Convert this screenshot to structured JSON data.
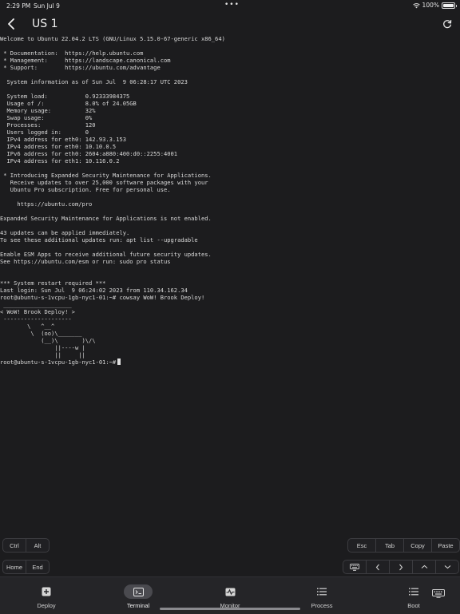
{
  "status_bar": {
    "time": "2:29 PM",
    "date": "Sun Jul 9",
    "battery": "100%",
    "battery_level": 1.0
  },
  "nav": {
    "title": "US 1",
    "back_icon": "chevron-left-icon",
    "refresh_icon": "refresh-icon"
  },
  "terminal": {
    "lines": [
      "Welcome to Ubuntu 22.04.2 LTS (GNU/Linux 5.15.0-67-generic x86_64)",
      "",
      " * Documentation:  https://help.ubuntu.com",
      " * Management:     https://landscape.canonical.com",
      " * Support:        https://ubuntu.com/advantage",
      "",
      "  System information as of Sun Jul  9 06:28:17 UTC 2023",
      "",
      "  System load:           0.92333984375",
      "  Usage of /:            8.0% of 24.05GB",
      "  Memory usage:          32%",
      "  Swap usage:            0%",
      "  Processes:             120",
      "  Users logged in:       0",
      "  IPv4 address for eth0: 142.93.3.153",
      "  IPv4 address for eth0: 10.10.0.5",
      "  IPv6 address for eth0: 2604:a880:400:d0::2255:4001",
      "  IPv4 address for eth1: 10.116.0.2",
      "",
      " * Introducing Expanded Security Maintenance for Applications.",
      "   Receive updates to over 25,000 software packages with your",
      "   Ubuntu Pro subscription. Free for personal use.",
      "",
      "     https://ubuntu.com/pro",
      "",
      "Expanded Security Maintenance for Applications is not enabled.",
      "",
      "43 updates can be applied immediately.",
      "To see these additional updates run: apt list --upgradable",
      "",
      "Enable ESM Apps to receive additional future security updates.",
      "See https://ubuntu.com/esm or run: sudo pro status",
      "",
      "",
      "*** System restart required ***",
      "Last login: Sun Jul  9 06:24:02 2023 from 110.34.162.34",
      "root@ubuntu-s-1vcpu-1gb-nyc1-01:~# cowsay WoW! Brook Deploy!",
      " ____________________",
      "< WoW! Brook Deploy! >",
      " --------------------",
      "        \\   ^__^",
      "         \\  (oo)\\_______",
      "            (__)\\       )\\/\\",
      "                ||----w |",
      "                ||     ||",
      "root@ubuntu-s-1vcpu-1gb-nyc1-01:~#"
    ]
  },
  "keys": {
    "ctrl": "Ctrl",
    "alt": "Alt",
    "esc": "Esc",
    "tab": "Tab",
    "copy": "Copy",
    "paste": "Paste",
    "home": "Home",
    "end": "End"
  },
  "tabs": [
    {
      "label": "Deploy",
      "icon": "plus-square-icon"
    },
    {
      "label": "Terminal",
      "icon": "terminal-icon"
    },
    {
      "label": "Monitor",
      "icon": "pulse-icon"
    },
    {
      "label": "Process",
      "icon": "list-icon"
    },
    {
      "label": "Boot",
      "icon": "list-icon"
    }
  ],
  "colors": {
    "background": "#1c1c1e",
    "tab_bar": "#252528",
    "active_pill": "#4a4a4f"
  }
}
